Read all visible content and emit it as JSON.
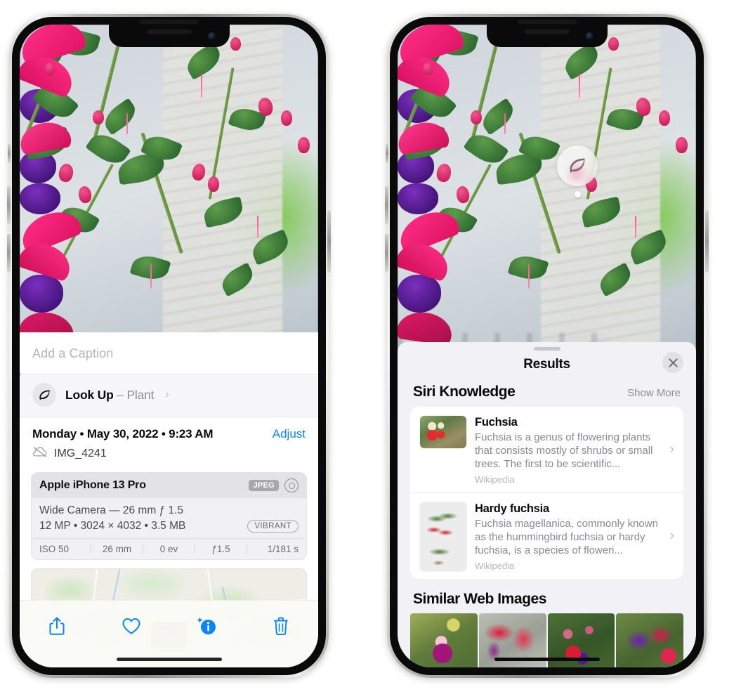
{
  "left_phone": {
    "name": "iphone-photos-info-view",
    "photo": {
      "alt": "Fuchsia flowers hanging basket on porch"
    },
    "caption_field": {
      "placeholder": "Add a Caption",
      "value": ""
    },
    "look_up": {
      "icon": "leaf-icon",
      "label_bold": "Look Up",
      "label_dash": " – ",
      "label_plain": "Plant",
      "chevron": "›"
    },
    "meta": {
      "date": "Monday • May 30, 2022 • 9:23 AM",
      "adjust_label": "Adjust",
      "cloud_icon": "icloud-slash-icon",
      "filename": "IMG_4241"
    },
    "exif": {
      "device": "Apple iPhone 13 Pro",
      "format_tag": "JPEG",
      "raw_icon": "aperture-icon",
      "lens": "Wide Camera — 26 mm ƒ 1.5",
      "size_line": "12 MP • 3024 × 4032 • 3.5 MB",
      "style_tag": "VIBRANT",
      "settings": [
        "ISO 50",
        "26 mm",
        "0 ev",
        "ƒ1.5",
        "1/181 s"
      ]
    },
    "map": {
      "label": "photo-location-map"
    },
    "toolbar": [
      {
        "name": "share-button",
        "icon": "share-icon"
      },
      {
        "name": "favorite-button",
        "icon": "heart-icon"
      },
      {
        "name": "info-button",
        "icon": "info-sparkle-icon"
      },
      {
        "name": "delete-button",
        "icon": "trash-icon"
      }
    ],
    "accent_color": "#0a84ff"
  },
  "right_phone": {
    "name": "iphone-visual-lookup-results",
    "photo_badge": {
      "icon": "leaf-icon",
      "name": "visual-lookup-badge"
    },
    "sheet": {
      "grabber": "drag-handle",
      "title": "Results",
      "close_icon": "close-icon"
    },
    "siri_knowledge": {
      "title": "Siri Knowledge",
      "show_more": "Show More",
      "items": [
        {
          "title": "Fuchsia",
          "desc": "Fuchsia is a genus of flowering plants that consists mostly of shrubs or small trees. The first to be scientific...",
          "source": "Wikipedia",
          "thumb": "fuchsia-red-flowers-thumbnail"
        },
        {
          "title": "Hardy fuchsia",
          "desc": "Fuchsia magellanica, commonly known as the hummingbird fuchsia or hardy fuchsia, is a species of floweri...",
          "source": "Wikipedia",
          "thumb": "hardy-fuchsia-specimen-thumbnail"
        }
      ]
    },
    "similar_web_images": {
      "title": "Similar Web Images",
      "items": [
        "fuchsia-pink-white-bloom",
        "fuchsia-red-closeup",
        "fuchsia-shrub-buds",
        "fuchsia-purple-red-cluster"
      ]
    },
    "sheet_bg_color": "#f1f1f6"
  }
}
